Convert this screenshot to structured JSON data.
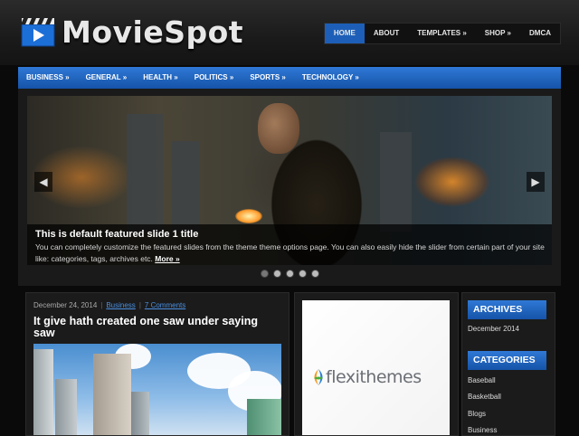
{
  "site": {
    "name": "MovieSpot"
  },
  "topnav": [
    {
      "label": "HOME",
      "active": true
    },
    {
      "label": "ABOUT",
      "active": false
    },
    {
      "label": "TEMPLATES »",
      "active": false
    },
    {
      "label": "SHOP »",
      "active": false
    },
    {
      "label": "DMCA",
      "active": false
    }
  ],
  "categories": [
    "BUSINESS »",
    "GENERAL »",
    "HEALTH »",
    "POLITICS »",
    "SPORTS »",
    "TECHNOLOGY »"
  ],
  "slider": {
    "title": "This is default featured slide 1 title",
    "text": "You can completely customize the featured slides from the theme theme options page. You can also easily hide the slider from certain part of your site like: categories, tags, archives etc.",
    "more": "More »",
    "prev_icon": "chevron-left-icon",
    "next_icon": "chevron-right-icon",
    "dot_count": 5,
    "active_dot": 0
  },
  "post": {
    "date": "December 24, 2014",
    "category": "Business",
    "comments": "7 Comments",
    "title": "It give hath created one saw under saying saw"
  },
  "ad": {
    "brand": "flexithemes"
  },
  "sidebar": {
    "archives_heading": "ARCHIVES",
    "archives": [
      "December 2014"
    ],
    "categories_heading": "CATEGORIES",
    "categories": [
      "Baseball",
      "Basketball",
      "Blogs",
      "Business"
    ]
  },
  "colors": {
    "accent": "#1d5fb8",
    "link": "#4a90e2"
  }
}
